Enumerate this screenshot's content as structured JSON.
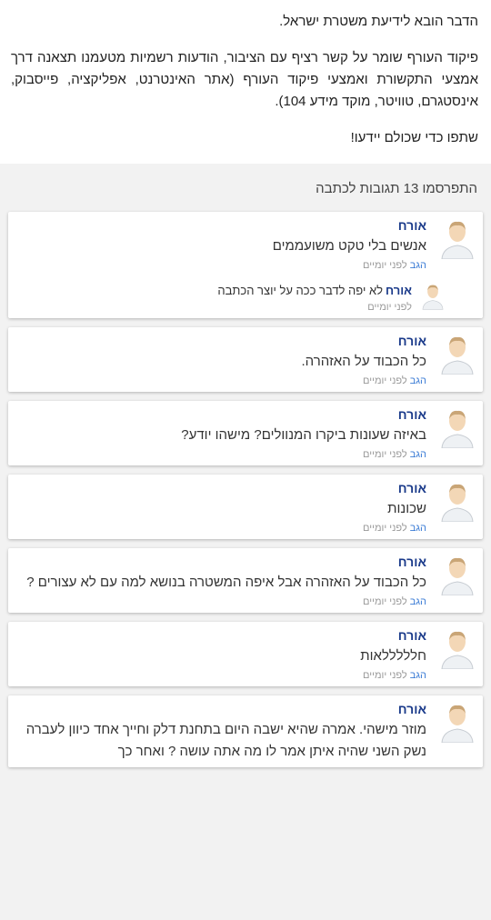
{
  "article": {
    "p1": "הדבר הובא לידיעת משטרת ישראל.",
    "p2": "פיקוד העורף שומר על קשר רציף עם הציבור, הודעות רשמיות מטעמנו תצאנה דרך אמצעי התקשורת ואמצעי פיקוד העורף (אתר האינטרנט, אפליקציה, פייסבוק, אינסטגרם, טוויטר, מוקד מידע 104).",
    "p3": "שתפו כדי שכולם יידעו!"
  },
  "comments_title": "התפרסמו 13 תגובות לכתבה",
  "reply_label": "הגב",
  "time_label": "לפני יומיים",
  "comments": [
    {
      "author": "אורח",
      "text": "אנשים בלי טקט משועממים",
      "reply": {
        "author": "אורח",
        "text": "לא יפה לדבר ככה על יוצר הכתבה",
        "time": "לפני יומיים"
      }
    },
    {
      "author": "אורח",
      "text": "כל הכבוד על האזהרה."
    },
    {
      "author": "אורח",
      "text": "באיזה שעונות ביקרו המנוולים? מישהו יודע?"
    },
    {
      "author": "אורח",
      "text": "שכונות"
    },
    {
      "author": "אורח",
      "text": "כל הכבוד על האזהרה אבל איפה המשטרה בנושא למה עם לא עצורים ?"
    },
    {
      "author": "אורח",
      "text": "חלללללאות"
    },
    {
      "author": "אורח",
      "text": "מוזר מישהי. אמרה שהיא ישבה היום בתחנת דלק וחייך אחד כיוון לעברה נשק השני שהיה איתן אמר לו מה אתה עושה ? ואחר כך"
    }
  ]
}
